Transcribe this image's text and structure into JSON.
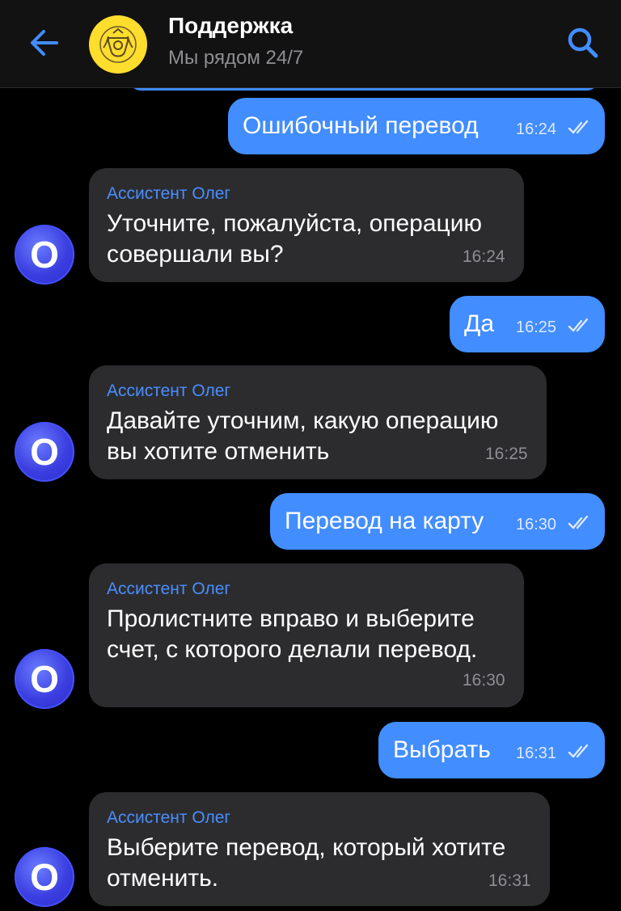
{
  "header": {
    "title": "Поддержка",
    "subtitle": "Мы рядом 24/7",
    "back_icon": "arrow-left-icon",
    "search_icon": "search-icon",
    "accent": "#428dff",
    "logo_bg": "#ffdd2d"
  },
  "messages": [
    {
      "type": "out",
      "text": "Ошибочный перевод",
      "time": "16:24"
    },
    {
      "type": "in",
      "sender": "Ассистент Олег",
      "lines": [
        "Уточните, пожалуйста, операцию",
        "совершали вы?"
      ],
      "time": "16:24"
    },
    {
      "type": "out",
      "text": "Да",
      "time": "16:25"
    },
    {
      "type": "in",
      "sender": "Ассистент Олег",
      "lines": [
        "Давайте уточним, какую операцию",
        "вы хотите отменить"
      ],
      "time": "16:25"
    },
    {
      "type": "out",
      "text": "Перевод на карту",
      "time": "16:30"
    },
    {
      "type": "in",
      "sender": "Ассистент Олег",
      "lines": [
        "Пролистните вправо и выберите",
        "счет, с которого делали перевод."
      ],
      "time": "16:30"
    },
    {
      "type": "out",
      "text": "Выбрать",
      "time": "16:31"
    },
    {
      "type": "in",
      "sender": "Ассистент Олег",
      "lines": [
        "Выберите перевод, который хотите",
        "отменить."
      ],
      "time": "16:31"
    }
  ],
  "avatar_letter": "O"
}
